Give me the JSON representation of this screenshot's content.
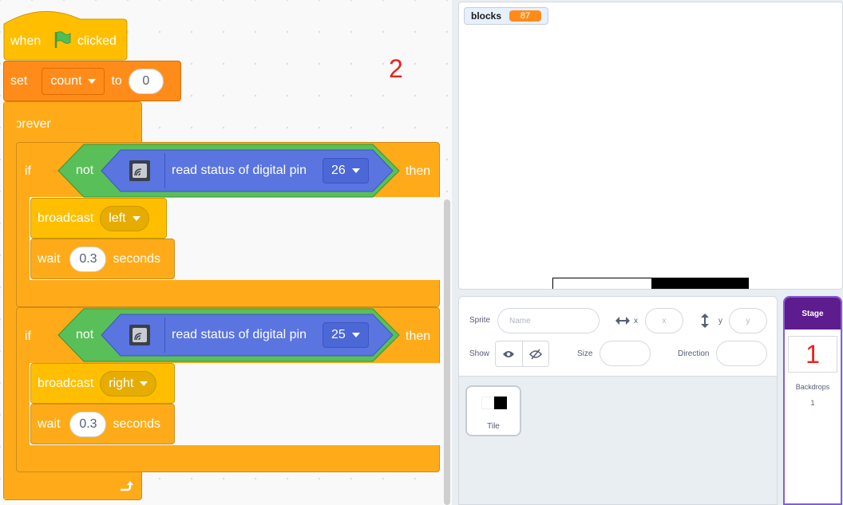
{
  "script": {
    "hat": {
      "when": "when",
      "clicked": "clicked"
    },
    "set": {
      "label": "set",
      "variable": "count",
      "to": "to",
      "value": "0"
    },
    "forever": "forever",
    "if1": {
      "if": "if",
      "not": "not",
      "read": "read status of digital pin",
      "pin": "26",
      "then": "then",
      "broadcast": "broadcast",
      "message": "left",
      "wait": "wait",
      "seconds_value": "0.3",
      "seconds": "seconds"
    },
    "if2": {
      "if": "if",
      "not": "not",
      "read": "read status of digital pin",
      "pin": "25",
      "then": "then",
      "broadcast": "broadcast",
      "message": "right",
      "wait": "wait",
      "seconds_value": "0.3",
      "seconds": "seconds"
    }
  },
  "annotations": {
    "one": "1",
    "two": "2"
  },
  "stage": {
    "monitor_label": "blocks",
    "monitor_value": "87"
  },
  "sprite_info": {
    "sprite_label": "Sprite",
    "name_placeholder": "Name",
    "x_label": "x",
    "x_placeholder": "x",
    "y_label": "y",
    "y_placeholder": "y",
    "show_label": "Show",
    "size_label": "Size",
    "direction_label": "Direction"
  },
  "sprites": [
    {
      "name": "Tile"
    }
  ],
  "stage_selector": {
    "title": "Stage",
    "backdrops_label": "Backdrops",
    "backdrops_count": "1"
  },
  "colors": {
    "events": "#ffbf00",
    "variables": "#ff8c1a",
    "control": "#ffab19",
    "operators": "#59c059",
    "extension": "#5a74e0",
    "stage_header": "#5e1d8e"
  },
  "icons": [
    "green-flag-icon",
    "board-chip-icon",
    "loop-arrow-icon",
    "horizontal-arrows-icon",
    "vertical-arrows-icon",
    "eye-icon",
    "eye-slash-icon"
  ]
}
